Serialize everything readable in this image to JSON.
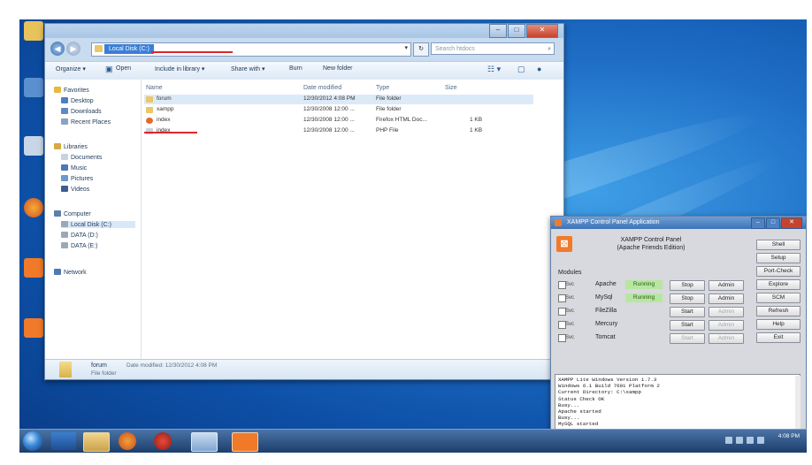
{
  "explorer": {
    "address": "Local Disk (C:)",
    "search_placeholder": "Search htdocs",
    "toolbar": [
      "Organize ▾",
      "Open",
      "Include in library ▾",
      "Share with ▾",
      "Burn",
      "New folder"
    ],
    "nav": {
      "favorites": "Favorites",
      "favorites_items": [
        "Desktop",
        "Downloads",
        "Recent Places"
      ],
      "libraries": "Libraries",
      "libraries_items": [
        "Documents",
        "Music",
        "Pictures",
        "Videos"
      ],
      "computer": "Computer",
      "computer_items": [
        "Local Disk (C:)",
        "DATA (D:)",
        "DATA (E:)"
      ],
      "network": "Network"
    },
    "columns": [
      "Name",
      "Date modified",
      "Type",
      "Size"
    ],
    "files": [
      {
        "name": "forum",
        "date": "12/30/2012 4:08 PM",
        "type": "File folder",
        "size": ""
      },
      {
        "name": "xampp",
        "date": "12/30/2008 12:00 ...",
        "type": "File folder",
        "size": ""
      },
      {
        "name": "index",
        "date": "12/30/2008 12:00 ...",
        "type": "Firefox HTML Doc...",
        "size": "1 KB"
      },
      {
        "name": "index",
        "date": "12/30/2008 12:00 ...",
        "type": "PHP File",
        "size": "1 KB"
      }
    ],
    "details": {
      "name": "forum",
      "modified": "Date modified: 12/30/2012 4:08 PM",
      "type": "File folder"
    }
  },
  "xampp": {
    "title": "XAMPP Control Panel Application",
    "header": [
      "XAMPP Control Panel",
      "(Apache Friends Edition)"
    ],
    "modules_label": "Modules",
    "services": [
      {
        "svc": "Svc",
        "name": "Apache",
        "status": "Running",
        "action": "Stop",
        "admin": "Admin"
      },
      {
        "svc": "Svc",
        "name": "MySql",
        "status": "Running",
        "action": "Stop",
        "admin": "Admin"
      },
      {
        "svc": "Svc",
        "name": "FileZilla",
        "status": "",
        "action": "Start",
        "admin": "Admin"
      },
      {
        "svc": "Svc",
        "name": "Mercury",
        "status": "",
        "action": "Start",
        "admin": "Admin"
      },
      {
        "svc": "Svc",
        "name": "Tomcat",
        "status": "",
        "action": "Start",
        "admin": "Admin"
      }
    ],
    "side_buttons": [
      "Shell",
      "Setup",
      "Port-Check",
      "Explore",
      "SCM",
      "Refresh",
      "Help",
      "Exit"
    ],
    "log": [
      "XAMPP Lite Windows Version 1.7.3",
      "Windows 6.1 Build 7601 Platform 2",
      "Current Directory: C:\\xampp",
      "Status Check OK",
      "Busy...",
      "Apache started",
      "Busy...",
      "MySQL started"
    ]
  },
  "taskbar": {
    "time": "4:08 PM",
    "date": ""
  },
  "colors": {
    "accent": "#3a7ed6",
    "highlight": "#e0262b",
    "running": "#b7e6a0",
    "xampp": "#f07a2a"
  }
}
